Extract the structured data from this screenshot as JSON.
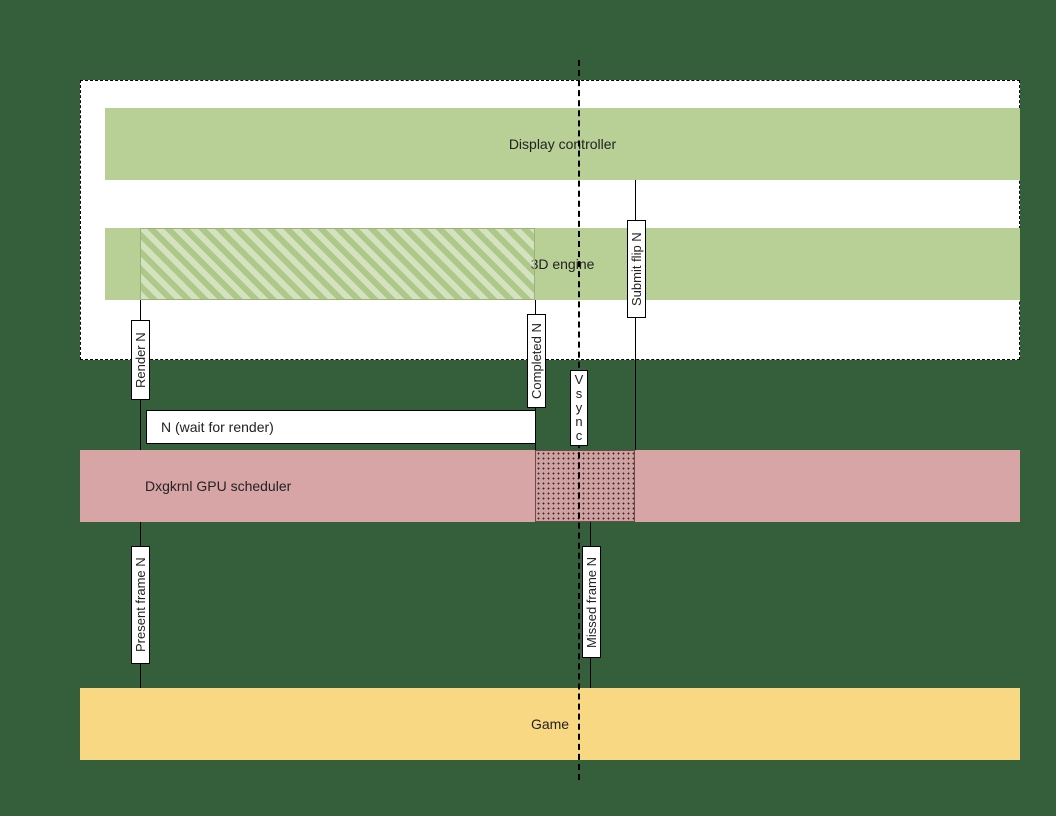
{
  "diagram": {
    "gpu_group_label": "",
    "lanes": {
      "display_controller": "Display controller",
      "engine3d": "3D engine",
      "dxgkrnl": "Dxgkrnl GPU scheduler",
      "game": "Game"
    },
    "boxes": {
      "wait_for_render": "N (wait for render)"
    },
    "labels": {
      "render_n": "Render N",
      "completed_n": "Completed N",
      "submit_flip_n": "Submit flip N",
      "vsync": "Vsync",
      "present_frame_n": "Present frame N",
      "missed_frame_n": "Missed frame N"
    }
  }
}
